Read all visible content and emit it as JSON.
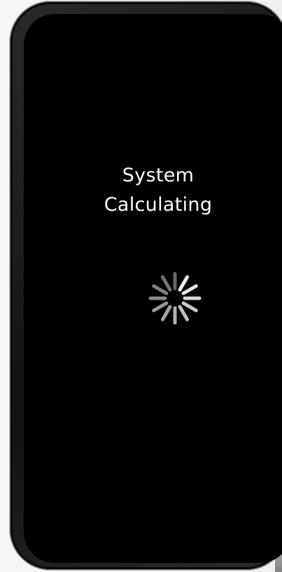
{
  "screen": {
    "title_line1": "System",
    "title_line2": "Calculating"
  },
  "icons": {
    "camera": "camera-icon",
    "speaker": "speaker-icon",
    "spinner": "loading-spinner-icon"
  },
  "colors": {
    "screen_background": "#000000",
    "text": "#ffffff",
    "spinner_segments": [
      "#f2f2f2",
      "#e5e5e5",
      "#d9d9d9",
      "#cccccc",
      "#bfbfbf",
      "#b2b2b2",
      "#a5a5a5",
      "#999999",
      "#8c8c8c",
      "#7f7f7f",
      "#737373",
      "#666666"
    ]
  }
}
